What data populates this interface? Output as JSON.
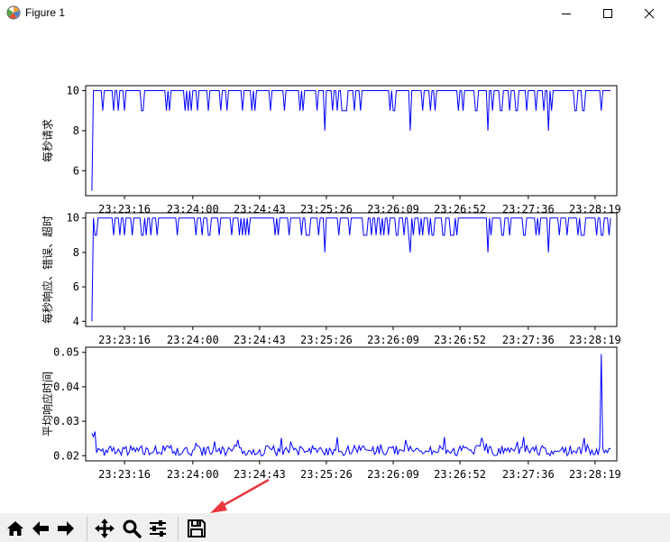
{
  "window": {
    "title": "Figure 1",
    "icon": "matplotlib-logo-icon",
    "controls": [
      "minimize-icon",
      "maximize-icon",
      "close-icon"
    ]
  },
  "toolbar": {
    "buttons": [
      {
        "name": "home-button",
        "icon": "home-icon"
      },
      {
        "name": "back-button",
        "icon": "arrow-left-icon"
      },
      {
        "name": "forward-button",
        "icon": "arrow-right-icon"
      },
      {
        "name": "pan-button",
        "icon": "move-icon"
      },
      {
        "name": "zoom-button",
        "icon": "magnifier-icon"
      },
      {
        "name": "configure-subplots-button",
        "icon": "sliders-icon"
      },
      {
        "name": "save-button",
        "icon": "floppy-disk-icon"
      }
    ]
  },
  "annotation": {
    "type": "arrow",
    "color": "#e8383d",
    "points_to": "save-button"
  },
  "chart_data": [
    {
      "type": "line",
      "ylabel": "每秒请求",
      "line_color": "#0000ff",
      "grid": false,
      "xticks": [
        "23:23:16",
        "23:24:00",
        "23:24:43",
        "23:25:26",
        "23:26:09",
        "23:26:52",
        "23:27:36",
        "23:28:19"
      ],
      "yticks": [
        "6",
        "8",
        "10"
      ],
      "ylim": [
        4.75,
        10.25
      ],
      "x_start": "23:22:55",
      "x_end": "23:28:29",
      "sampling": "1 value per second",
      "values_description": "starts at 5, jumps to 10; mostly 10 with frequent single-second dips to 9 and occasional dips to 8"
    },
    {
      "type": "line",
      "ylabel": "每秒响应、错误、超时",
      "line_color": "#0000ff",
      "grid": false,
      "xticks": [
        "23:23:16",
        "23:24:00",
        "23:24:43",
        "23:25:26",
        "23:26:09",
        "23:26:52",
        "23:27:36",
        "23:28:19"
      ],
      "yticks": [
        "4",
        "6",
        "8",
        "10"
      ],
      "ylim": [
        3.7,
        10.3
      ],
      "x_start": "23:22:55",
      "x_end": "23:28:29",
      "sampling": "1 value per second",
      "values_description": "starts at 4, jumps to 10; mostly 10 with frequent dips to 9 and occasional dips to 8"
    },
    {
      "type": "line",
      "ylabel": "平均响应时间",
      "line_color": "#0000ff",
      "grid": false,
      "xticks": [
        "23:23:16",
        "23:24:00",
        "23:24:43",
        "23:25:26",
        "23:26:09",
        "23:26:52",
        "23:27:36",
        "23:28:19"
      ],
      "yticks": [
        "0.02",
        "0.03",
        "0.04",
        "0.05"
      ],
      "ylim": [
        0.0185,
        0.0515
      ],
      "x_start": "23:22:55",
      "x_end": "23:28:29",
      "sampling": "1 value per second",
      "values_description": "starts near 0.027, noisy baseline 0.020–0.025, single spike to about 0.050 near 23:28:23"
    }
  ]
}
